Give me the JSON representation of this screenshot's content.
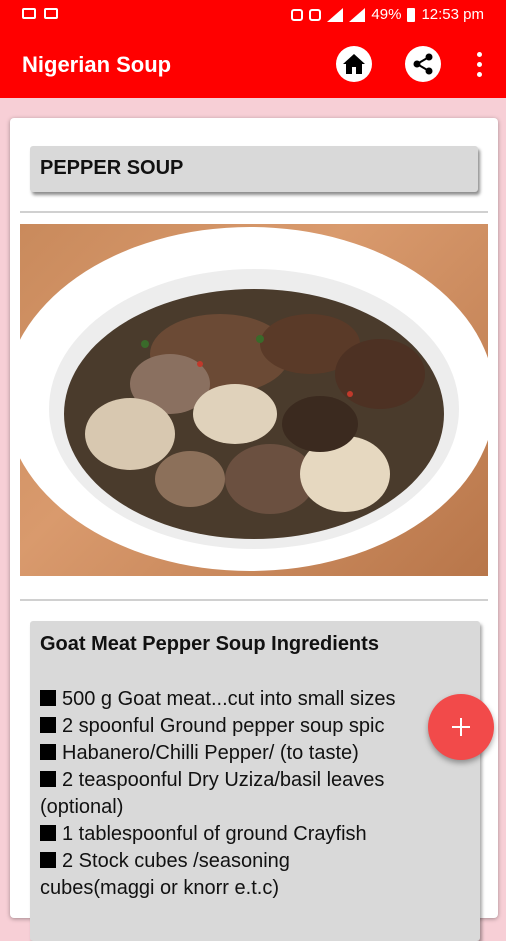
{
  "status_bar": {
    "battery": "49%",
    "time": "12:53 pm"
  },
  "app_bar": {
    "title": "Nigerian Soup"
  },
  "recipe": {
    "title": "PEPPER SOUP",
    "ingredients_title": "Goat Meat Pepper Soup Ingredients",
    "ingredients": [
      "500 g Goat meat...cut into small sizes",
      "2 spoonful Ground pepper soup spic",
      "Habanero/Chilli Pepper/ (to taste)",
      "2 teaspoonful Dry Uziza/basil leaves",
      "(optional)",
      "1 tablespoonful of ground Crayfish",
      "2 Stock cubes /seasoning",
      "cubes(maggi or knorr e.t.c)"
    ]
  },
  "colors": {
    "accent": "#ff0000",
    "fab": "#f24a4a",
    "background": "#f7cfd6"
  },
  "icons": [
    "home-icon",
    "share-icon",
    "more-vert-icon",
    "add-icon"
  ]
}
